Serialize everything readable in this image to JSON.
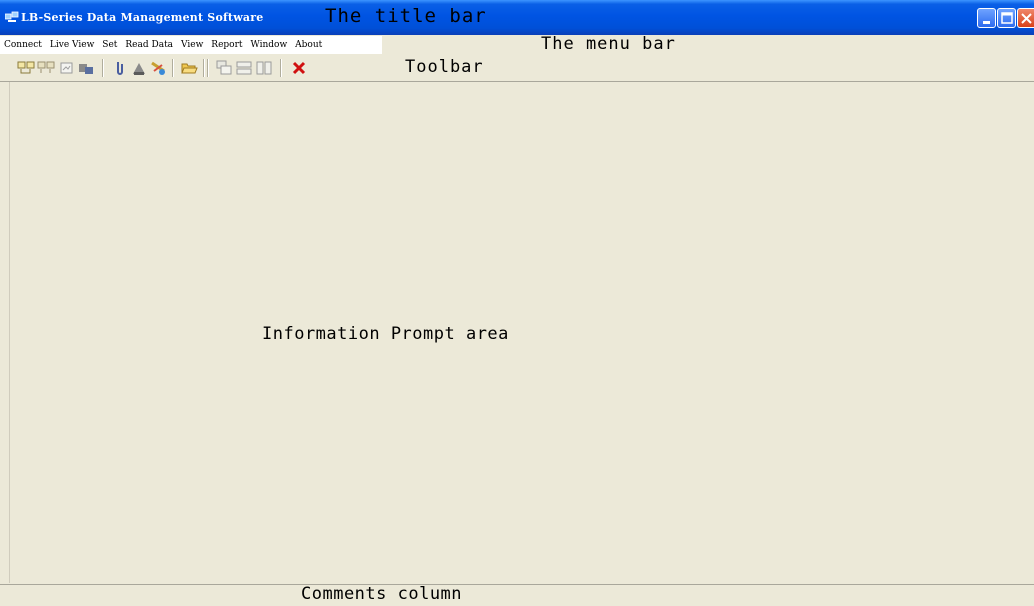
{
  "titlebar": {
    "title": "LB-Series Data Management Software",
    "annotation": "The title bar",
    "colors": {
      "bar": "#0054e3",
      "close": "#d8401a"
    }
  },
  "menubar": {
    "items": [
      {
        "label": "Connect"
      },
      {
        "label": "Live View"
      },
      {
        "label": "Set"
      },
      {
        "label": "Read Data"
      },
      {
        "label": "View"
      },
      {
        "label": "Report"
      },
      {
        "label": "Window"
      },
      {
        "label": "About"
      }
    ],
    "annotation": "The menu bar"
  },
  "toolbar": {
    "annotation": "Toolbar",
    "buttons": [
      {
        "icon": "connect-icon"
      },
      {
        "icon": "disconnect-icon"
      },
      {
        "icon": "live-view-icon"
      },
      {
        "icon": "settings-icon"
      },
      {
        "icon": "attach-icon"
      },
      {
        "icon": "upload-icon"
      },
      {
        "icon": "clear-icon"
      },
      {
        "icon": "open-folder-icon"
      },
      {
        "icon": "cascade-icon"
      },
      {
        "icon": "tile-horizontal-icon"
      },
      {
        "icon": "tile-vertical-icon"
      },
      {
        "icon": "exit-icon"
      }
    ]
  },
  "main": {
    "annotation": "Information Prompt area",
    "background": "#ece9d8"
  },
  "statusbar": {
    "annotation": "Comments column"
  }
}
